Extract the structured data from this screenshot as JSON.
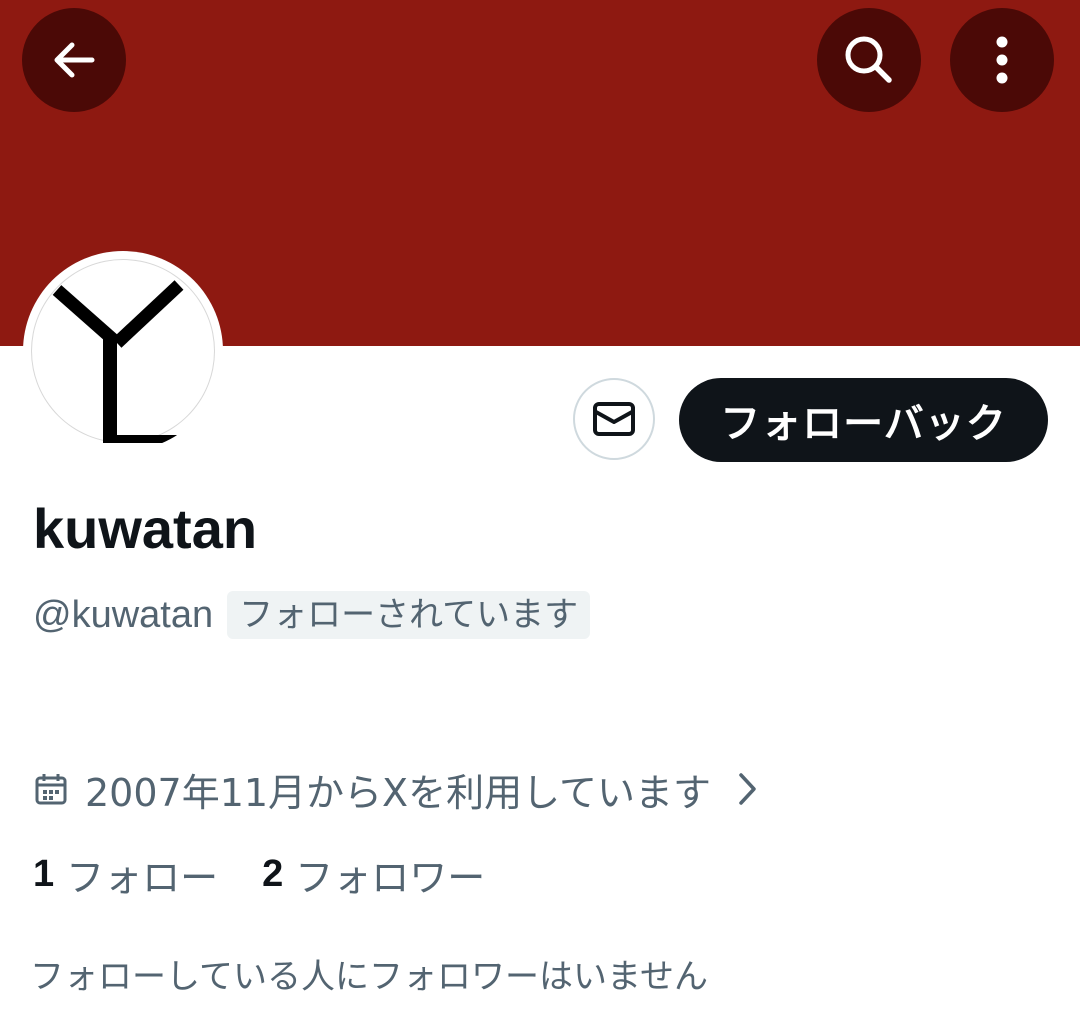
{
  "banner": {
    "color": "#8e1911"
  },
  "top_bar": {
    "back_icon": "arrow-left-icon",
    "search_icon": "search-icon",
    "more_icon": "more-vertical-icon"
  },
  "profile": {
    "display_name": "kuwatan",
    "handle": "@kuwatan",
    "follows_you_label": "フォローされています",
    "joined_text": "2007年11月からXを利用しています",
    "following_count": "1",
    "following_label": "フォロー",
    "followers_count": "2",
    "followers_label": "フォロワー",
    "mutual_followers_text": "フォローしている人にフォロワーはいません"
  },
  "actions": {
    "message_icon": "mail-icon",
    "follow_back_label": "フォローバック"
  },
  "colors": {
    "primary_text": "#0f1419",
    "secondary_text": "#536471",
    "button_dark": "#0f1419",
    "icon_button_bg": "#4b0906"
  }
}
